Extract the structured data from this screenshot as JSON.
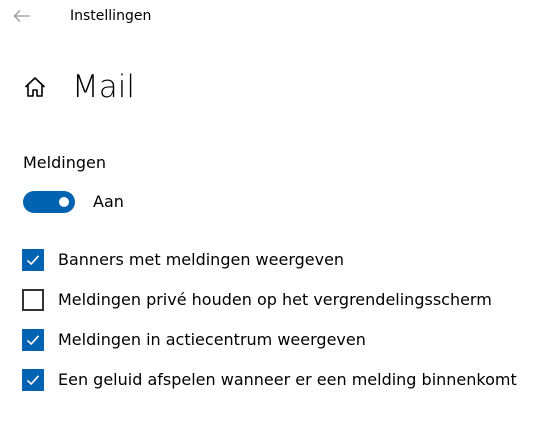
{
  "window": {
    "title": "Instellingen",
    "back_icon": "back-arrow-icon"
  },
  "header": {
    "home_icon": "home-icon",
    "title": "Mail"
  },
  "notifications": {
    "section_label": "Meldingen",
    "toggle": {
      "state": "on",
      "label": "Aan"
    },
    "options": [
      {
        "label": "Banners met meldingen weergeven",
        "checked": true
      },
      {
        "label": "Meldingen privé houden op het vergrendelingsscherm",
        "checked": false
      },
      {
        "label": "Meldingen in actiecentrum weergeven",
        "checked": true
      },
      {
        "label": "Een geluid afspelen wanneer er een melding binnenkomt",
        "checked": true
      }
    ]
  },
  "colors": {
    "accent": "#0063b1",
    "text": "#000000",
    "background": "#ffffff",
    "unchecked_border": "#333333"
  }
}
